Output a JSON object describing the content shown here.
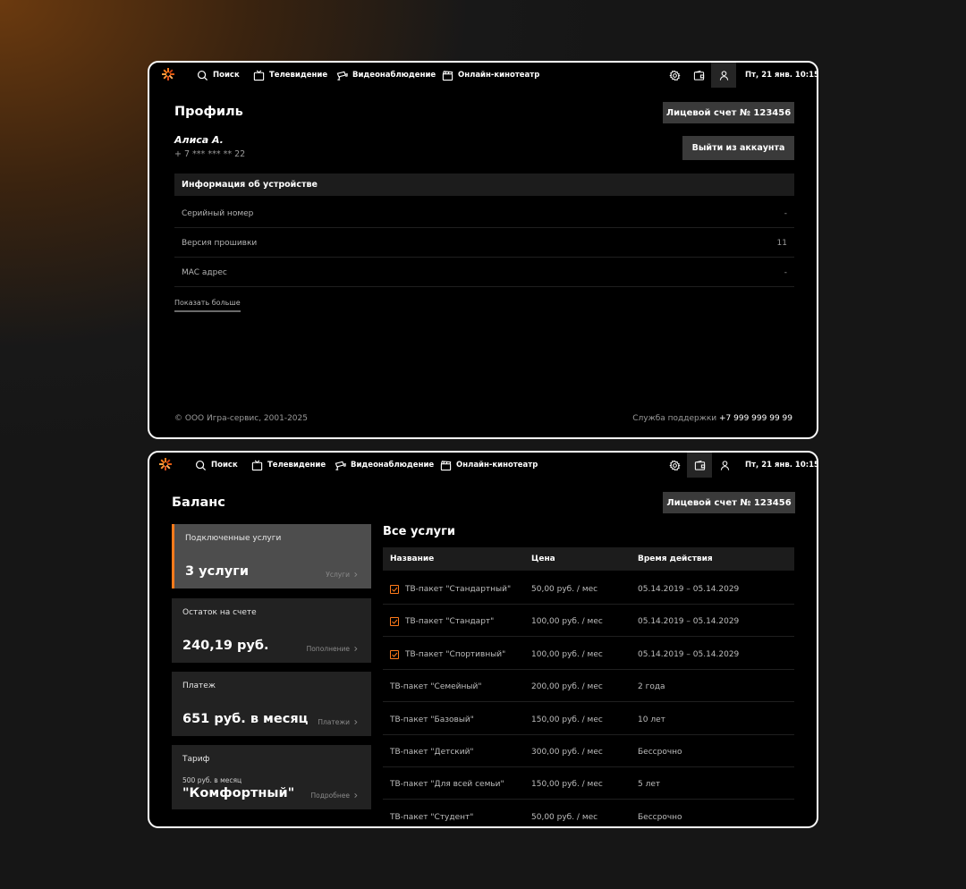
{
  "nav": {
    "search": "Поиск",
    "tv": "Телевидение",
    "video": "Видеонаблюдение",
    "cinema": "Онлайн-кинотеатр",
    "datetime": "Пт, 21 янв. 10:15"
  },
  "profile": {
    "title": "Профиль",
    "account_button": "Лицевой счет № 123456",
    "user_name": "Алиса А.",
    "user_phone": "+ 7 *** *** ** 22",
    "logout_button": "Выйти из аккаунта",
    "device_info_title": "Информация об устройстве",
    "device_info": [
      {
        "label": "Серийный номер",
        "value": "-"
      },
      {
        "label": "Версия прошивки",
        "value": "11"
      },
      {
        "label": "MAC адрес",
        "value": "-"
      }
    ],
    "show_more": "Показать больше",
    "copyright": "© ООО Игра-сервис, 2001-2025",
    "support_label": "Служба поддержки",
    "support_phone": "+7 999 999 99 99"
  },
  "balance": {
    "title": "Баланс",
    "account_button": "Лицевой счет № 123456",
    "cards": [
      {
        "label": "Подключенные услуги",
        "value": "3 услуги",
        "link": "Услуги"
      },
      {
        "label": "Остаток на счете",
        "value": "240,19 руб.",
        "link": "Пополнение"
      },
      {
        "label": "Платеж",
        "value": "651 руб. в месяц",
        "link": "Платежи"
      },
      {
        "label": "Тариф",
        "sub": "500 руб. в месяц",
        "value": "\"Комфортный\"",
        "link": "Подробнее"
      }
    ],
    "services_title": "Все услуги",
    "columns": [
      "Название",
      "Цена",
      "Время действия"
    ],
    "rows": [
      {
        "name": "ТВ-пакет \"Стандартный\"",
        "price": "50,00 руб. / мес",
        "period": "05.14.2019 – 05.14.2029",
        "checked": true
      },
      {
        "name": "ТВ-пакет \"Стандарт\"",
        "price": "100,00 руб. / мес",
        "period": "05.14.2019 – 05.14.2029",
        "checked": true
      },
      {
        "name": "ТВ-пакет \"Спортивный\"",
        "price": "100,00 руб. / мес",
        "period": "05.14.2019 – 05.14.2029",
        "checked": true
      },
      {
        "name": "ТВ-пакет \"Семейный\"",
        "price": "200,00 руб. / мес",
        "period": "2 года",
        "checked": false
      },
      {
        "name": "ТВ-пакет \"Базовый\"",
        "price": "150,00 руб. / мес",
        "period": "10 лет",
        "checked": false
      },
      {
        "name": "ТВ-пакет \"Детский\"",
        "price": "300,00 руб. / мес",
        "period": "Бессрочно",
        "checked": false
      },
      {
        "name": "ТВ-пакет \"Для всей семьи\"",
        "price": "150,00 руб. / мес",
        "period": "5 лет",
        "checked": false
      },
      {
        "name": "ТВ-пакет \"Студент\"",
        "price": "50,00 руб. / мес",
        "period": "Бессрочно",
        "checked": false
      }
    ]
  },
  "colors": {
    "accent": "#ff7a1a",
    "panel": "#222222",
    "active_panel": "#4d4d4d"
  },
  "icons": [
    "logo-icon",
    "search-icon",
    "tv-icon",
    "camera-icon",
    "cinema-icon",
    "settings-icon",
    "wallet-icon",
    "user-icon",
    "chevron-right-icon",
    "checkbox-icon"
  ]
}
